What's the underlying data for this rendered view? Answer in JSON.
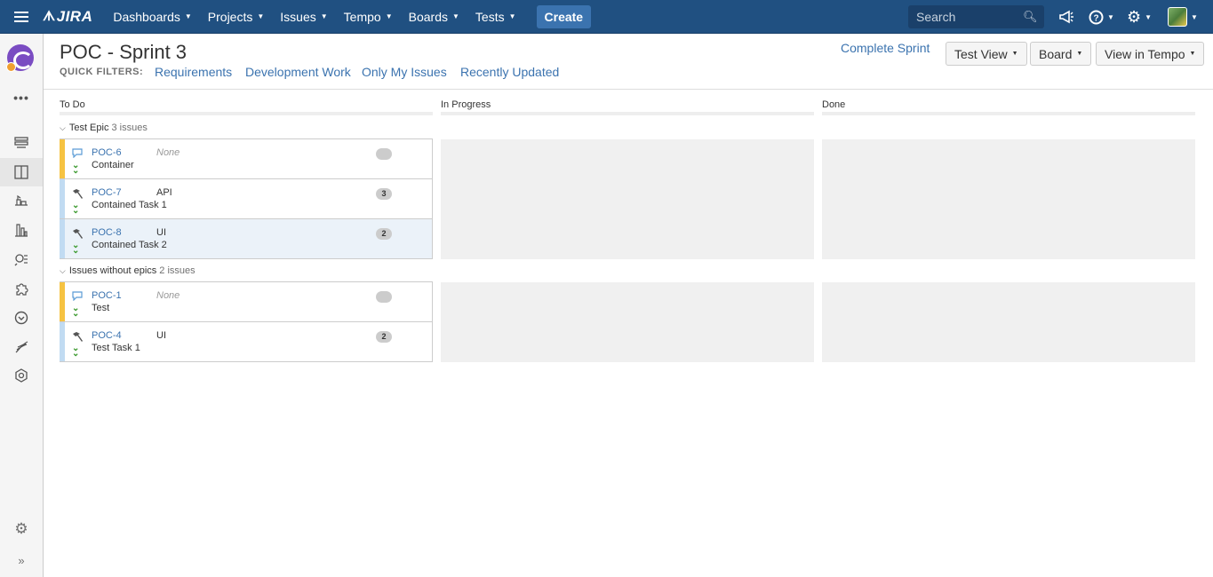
{
  "nav": {
    "logo": "JIRA",
    "items": [
      {
        "label": "Dashboards"
      },
      {
        "label": "Projects"
      },
      {
        "label": "Issues"
      },
      {
        "label": "Tempo"
      },
      {
        "label": "Boards"
      },
      {
        "label": "Tests"
      }
    ],
    "create_label": "Create",
    "search_placeholder": "Search"
  },
  "header": {
    "title": "POC - Sprint 3",
    "quick_filters_label": "QUICK FILTERS:",
    "quick_filters": [
      "Requirements",
      "Development Work",
      "Only My Issues",
      "Recently Updated"
    ],
    "complete_sprint": "Complete Sprint",
    "buttons": [
      "Test View",
      "Board",
      "View in Tempo"
    ]
  },
  "columns": [
    "To Do",
    "In Progress",
    "Done"
  ],
  "swimlanes": [
    {
      "name": "Test Epic",
      "count": "3 issues",
      "issues": [
        {
          "key": "POC-6",
          "epic": "None",
          "summary": "Container",
          "estimate": "",
          "type": "story"
        },
        {
          "key": "POC-7",
          "epic": "API",
          "summary": "Contained Task 1",
          "estimate": "3",
          "type": "task"
        },
        {
          "key": "POC-8",
          "epic": "UI",
          "summary": "Contained Task 2",
          "estimate": "2",
          "type": "task"
        }
      ]
    },
    {
      "name": "Issues without epics",
      "count": "2 issues",
      "issues": [
        {
          "key": "POC-1",
          "epic": "None",
          "summary": "Test",
          "estimate": "",
          "type": "story"
        },
        {
          "key": "POC-4",
          "epic": "UI",
          "summary": "Test Task 1",
          "estimate": "2",
          "type": "task"
        }
      ]
    }
  ],
  "colors": {
    "nav_bg": "#205081",
    "link": "#3b73af",
    "story_grabber": "#f6c342",
    "task_grabber": "#c1dbf2",
    "priority": "#3c9a2f"
  }
}
